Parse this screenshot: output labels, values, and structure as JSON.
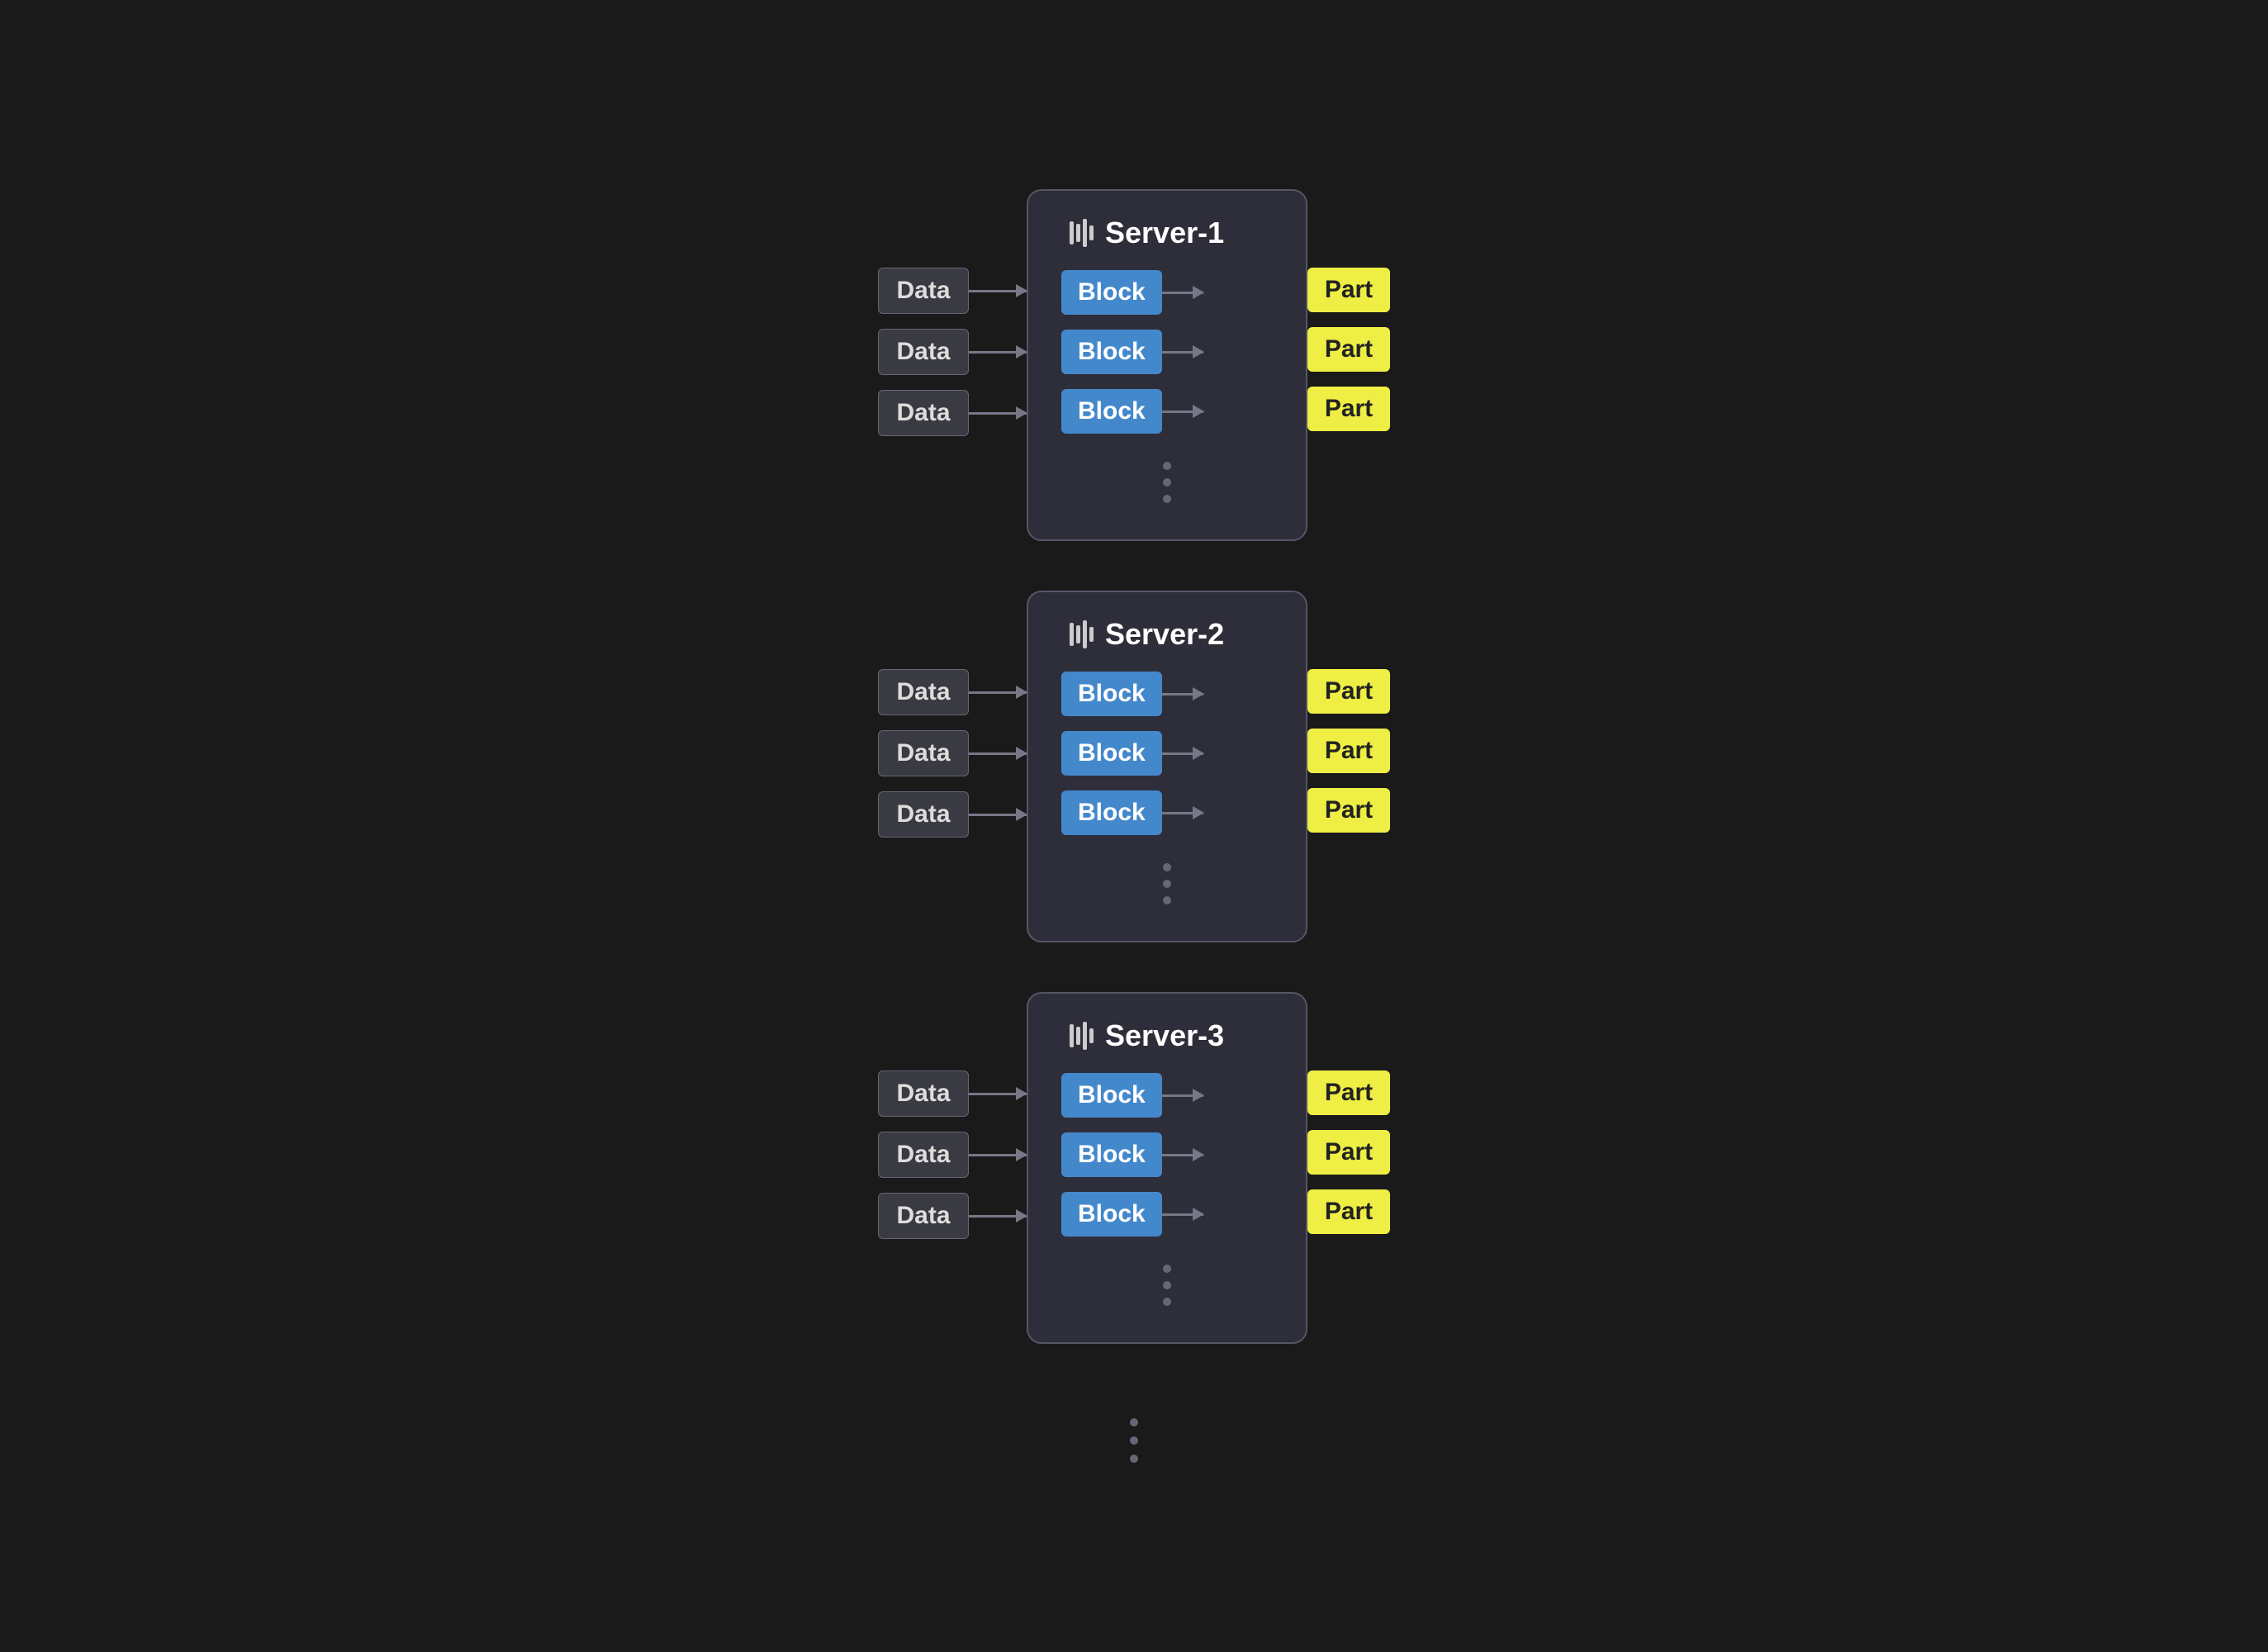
{
  "diagram": {
    "background": "#1a1a1a",
    "servers": [
      {
        "id": "server-1",
        "label": "Server-1",
        "rows": [
          {
            "data": "Data",
            "block": "Block",
            "part": "Part"
          },
          {
            "data": "Data",
            "block": "Block",
            "part": "Part"
          },
          {
            "data": "Data",
            "block": "Block",
            "part": "Part"
          }
        ]
      },
      {
        "id": "server-2",
        "label": "Server-2",
        "rows": [
          {
            "data": "Data",
            "block": "Block",
            "part": "Part"
          },
          {
            "data": "Data",
            "block": "Block",
            "part": "Part"
          },
          {
            "data": "Data",
            "block": "Block",
            "part": "Part"
          }
        ]
      },
      {
        "id": "server-3",
        "label": "Server-3",
        "rows": [
          {
            "data": "Data",
            "block": "Block",
            "part": "Part"
          },
          {
            "data": "Data",
            "block": "Block",
            "part": "Part"
          },
          {
            "data": "Data",
            "block": "Block",
            "part": "Part"
          }
        ]
      }
    ]
  }
}
